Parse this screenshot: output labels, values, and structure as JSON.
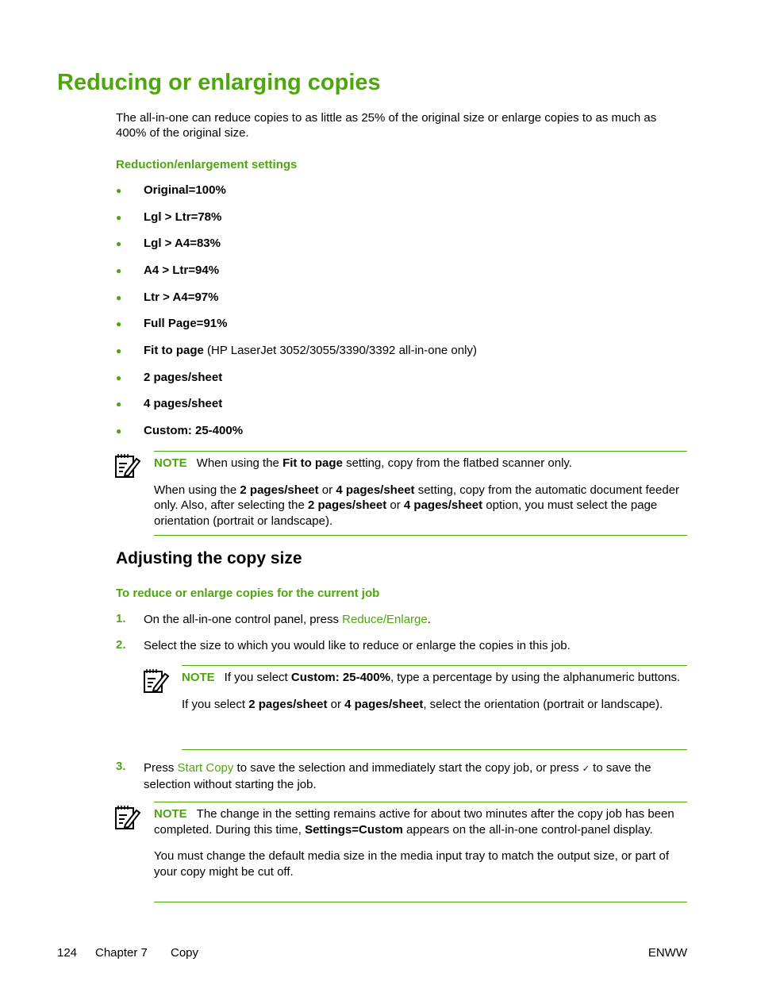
{
  "title": "Reducing or enlarging copies",
  "intro": "The all-in-one can reduce copies to as little as 25% of the original size or enlarge copies to as much as 400% of the original size.",
  "settings_heading": "Reduction/enlargement settings",
  "settings": [
    {
      "bold": "Original=100%",
      "rest": ""
    },
    {
      "bold": "Lgl > Ltr=78%",
      "rest": ""
    },
    {
      "bold": "Lgl > A4=83%",
      "rest": ""
    },
    {
      "bold": "A4 > Ltr=94%",
      "rest": ""
    },
    {
      "bold": "Ltr > A4=97%",
      "rest": ""
    },
    {
      "bold": "Full Page=91%",
      "rest": ""
    },
    {
      "bold": "Fit to page",
      "rest": " (HP LaserJet 3052/3055/3390/3392 all-in-one only)"
    },
    {
      "bold": "2 pages/sheet",
      "rest": ""
    },
    {
      "bold": "4 pages/sheet",
      "rest": ""
    },
    {
      "bold": "Custom: 25-400%",
      "rest": ""
    }
  ],
  "note_label": "NOTE",
  "note1": {
    "p1_a": "When using the ",
    "p1_b": "Fit to page",
    "p1_c": " setting, copy from the flatbed scanner only.",
    "p2_a": "When using the ",
    "p2_b": "2 pages/sheet",
    "p2_c": " or ",
    "p2_d": "4 pages/sheet",
    "p2_e": " setting, copy from the automatic document feeder only. Also, after selecting the ",
    "p2_f": "2 pages/sheet",
    "p2_g": " or ",
    "p2_h": "4 pages/sheet",
    "p2_i": " option, you must select the page orientation (portrait or landscape)."
  },
  "section_heading": "Adjusting the copy size",
  "procedure_heading": "To reduce or enlarge copies for the current job",
  "steps": [
    {
      "num": "1.",
      "a": "On the all-in-one control panel, press ",
      "link": "Reduce/Enlarge",
      "b": "."
    },
    {
      "num": "2.",
      "a": "Select the size to which you would like to reduce or enlarge the copies in this job."
    },
    {
      "num": "3.",
      "a": "Press ",
      "link": "Start Copy",
      "b": " to save the selection and immediately start the copy job, or press ",
      "check": "✓",
      "c": " to save the selection without starting the job."
    }
  ],
  "note2": {
    "p1_a": "If you select ",
    "p1_b": "Custom: 25-400%",
    "p1_c": ", type a percentage by using the alphanumeric buttons.",
    "p2_a": "If you select ",
    "p2_b": "2 pages/sheet",
    "p2_c": " or ",
    "p2_d": "4 pages/sheet",
    "p2_e": ", select the orientation (portrait or landscape)."
  },
  "note3": {
    "p1_a": "The change in the setting remains active for about two minutes after the copy job has been completed. During this time, ",
    "p1_b": "Settings=Custom",
    "p1_c": " appears on the all-in-one control-panel display.",
    "p2": "You must change the default media size in the media input tray to match the output size, or part of your copy might be cut off."
  },
  "footer": {
    "page": "124",
    "chapter": "Chapter 7",
    "section": "Copy",
    "right": "ENWW"
  },
  "colors": {
    "accent": "#4ea60e"
  }
}
